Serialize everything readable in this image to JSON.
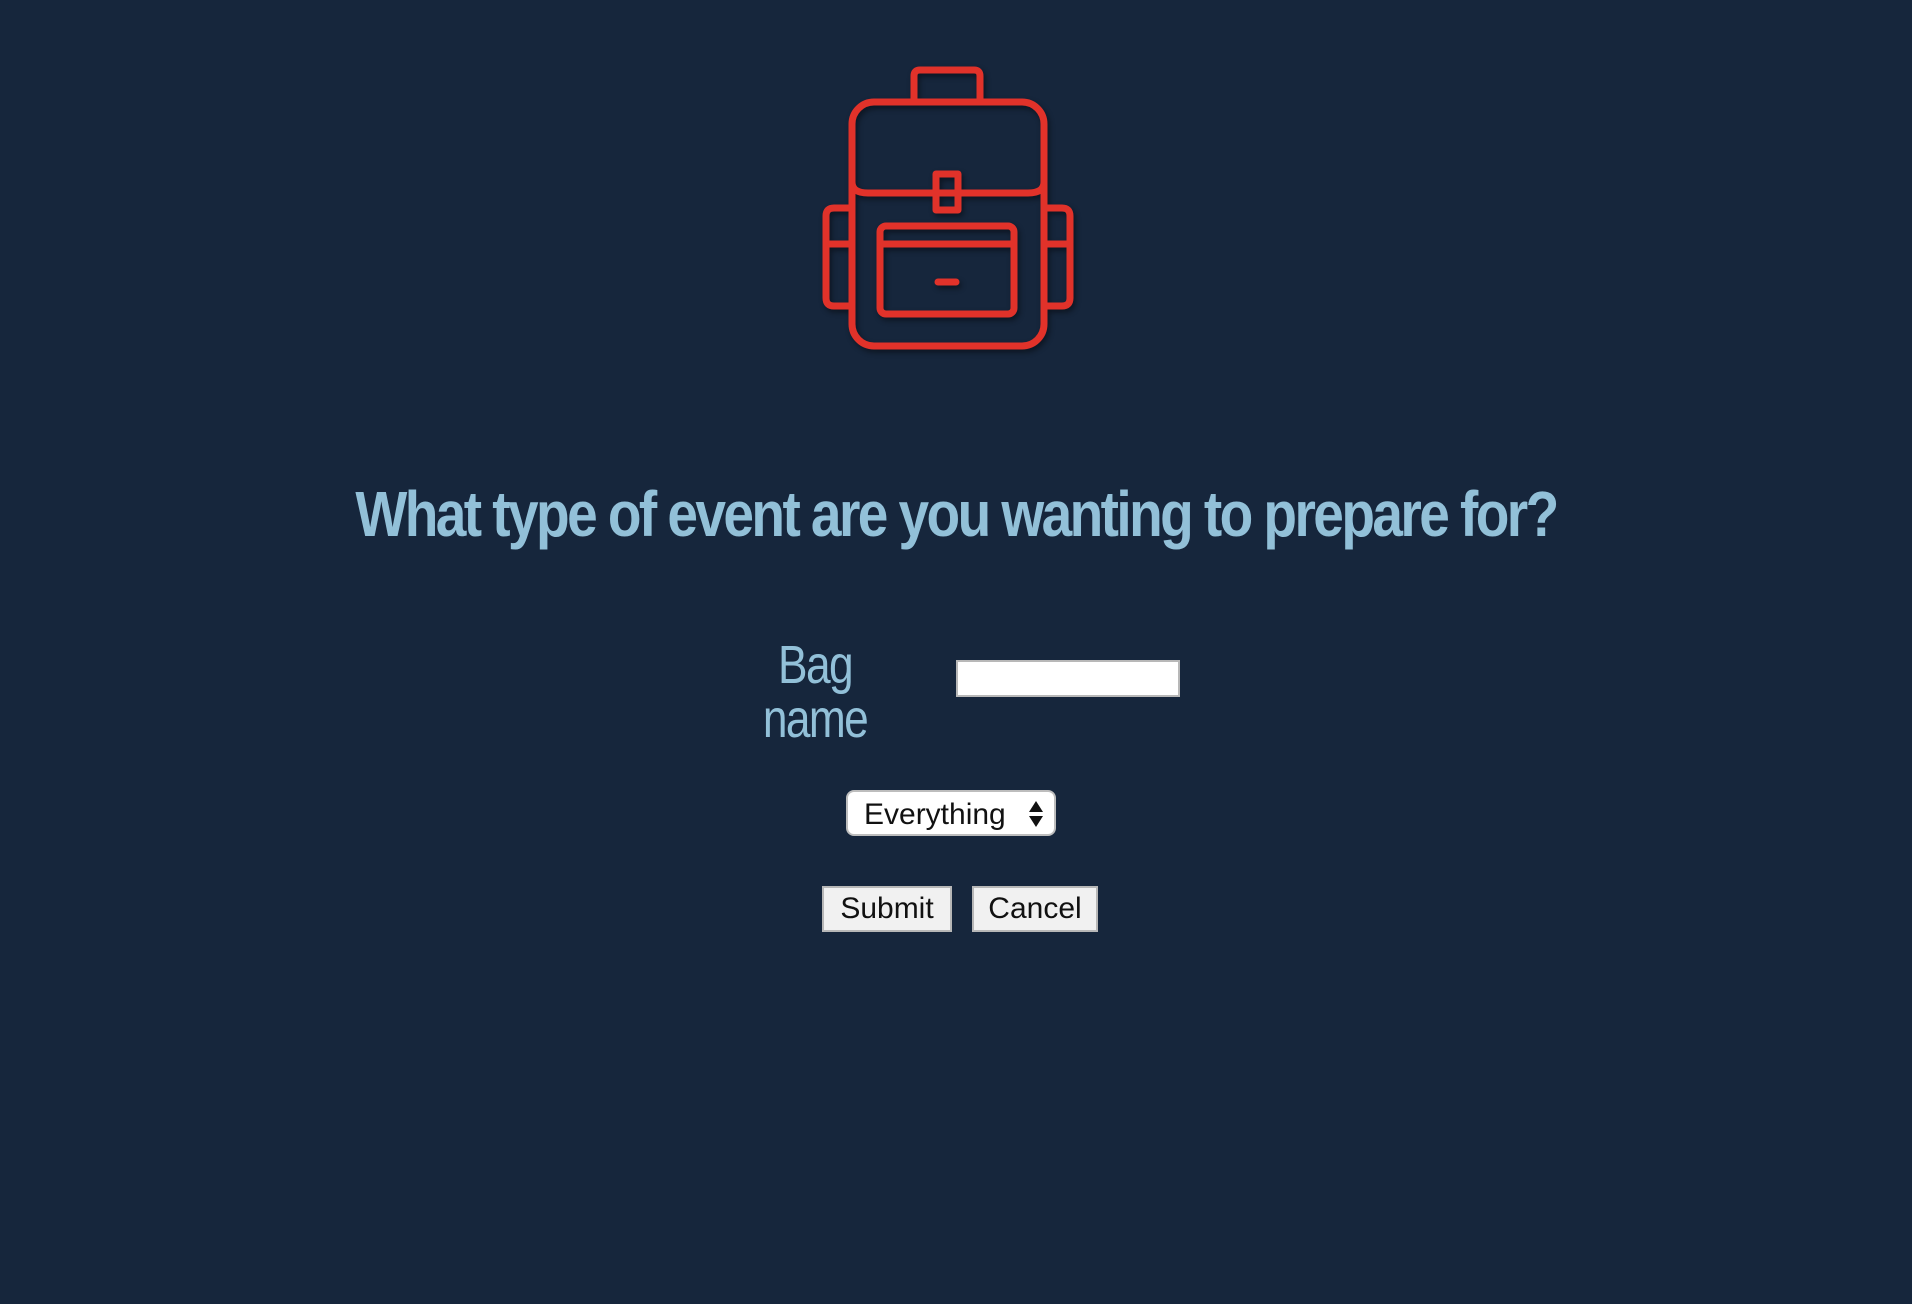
{
  "logo": {
    "icon": "backpack-icon",
    "color": "#e1322a"
  },
  "form": {
    "question": "What type of event are you wanting to prepare for?",
    "bag_name_label": "Bag name",
    "bag_name_value": "",
    "event_type_selected": "Everything",
    "submit_label": "Submit",
    "cancel_label": "Cancel"
  },
  "colors": {
    "background": "#16263c",
    "heading": "#92c0d8",
    "accent": "#e1322a"
  }
}
